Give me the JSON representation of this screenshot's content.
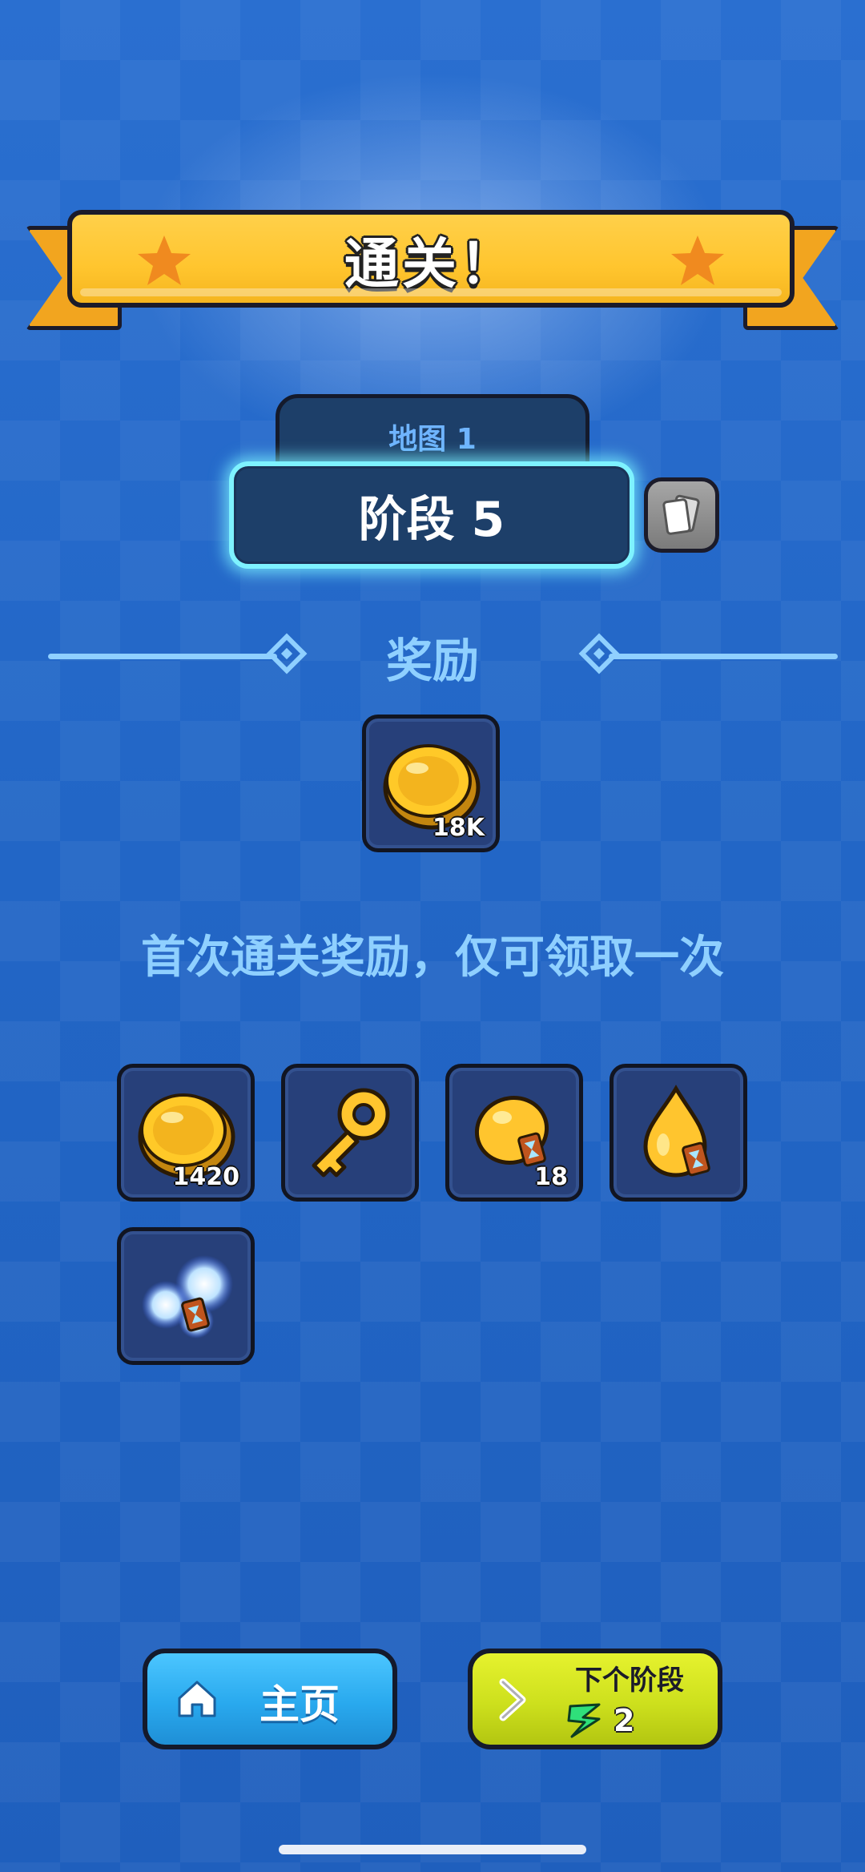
{
  "banner": {
    "title": "通关！"
  },
  "stage": {
    "map_label": "地图 1",
    "stage_label": "阶段 5"
  },
  "rewards": {
    "title": "奖励",
    "main_items": [
      {
        "icon": "gold-coin-icon",
        "qty": "18K"
      }
    ],
    "first_clear_text": "首次通关奖励，仅可领取一次",
    "first_clear_items": [
      {
        "icon": "gold-coin-icon",
        "qty": "1420"
      },
      {
        "icon": "golden-key-icon",
        "qty": ""
      },
      {
        "icon": "gold-bean-hourglass-icon",
        "qty": "18"
      },
      {
        "icon": "gold-drop-hourglass-icon",
        "qty": ""
      },
      {
        "icon": "blue-orb-hourglass-icon",
        "qty": ""
      }
    ]
  },
  "buttons": {
    "home_label": "主页",
    "next_label": "下个阶段",
    "next_energy_cost": "2"
  },
  "colors": {
    "background": "#2266c6",
    "banner": "#ffc52e",
    "accent_text": "#8fd0ff",
    "home_button": "#29a9ee",
    "next_button": "#cde01d"
  }
}
